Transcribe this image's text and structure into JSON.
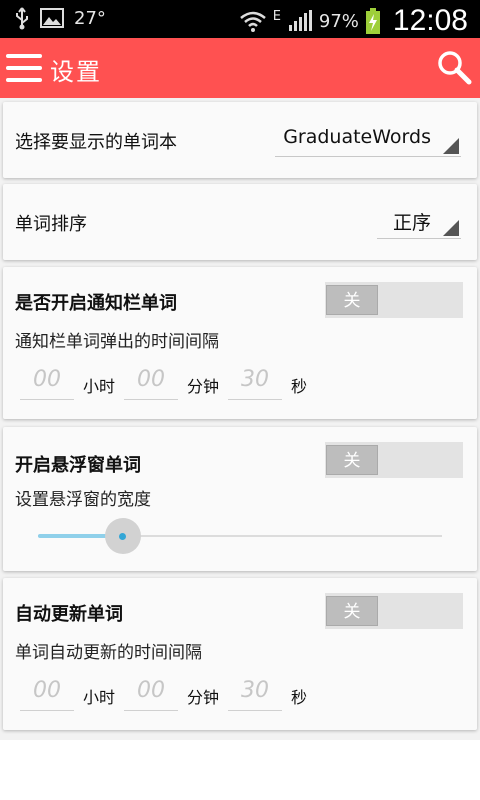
{
  "status_bar": {
    "temperature": "27°",
    "network_type": "E",
    "battery": "97%",
    "time": "12:08",
    "icons": [
      "usb-icon",
      "image-icon",
      "wifi-icon",
      "signal-icon",
      "battery-charging-icon"
    ]
  },
  "app_bar": {
    "title": "设置",
    "menu_icon": "hamburger-menu-icon",
    "search_icon": "search-icon",
    "color": "#ff5151"
  },
  "wordbook": {
    "label": "选择要显示的单词本",
    "selected": "GraduateWords"
  },
  "sort": {
    "label": "单词排序",
    "selected": "正序"
  },
  "notification": {
    "label": "是否开启通知栏单词",
    "toggle_text": "关",
    "interval_label": "通知栏单词弹出的时间间隔",
    "hours_placeholder": "00",
    "hours_unit": "小时",
    "minutes_placeholder": "00",
    "minutes_unit": "分钟",
    "seconds_placeholder": "30",
    "seconds_unit": "秒"
  },
  "floating": {
    "label": "开启悬浮窗单词",
    "toggle_text": "关",
    "width_label": "设置悬浮窗的宽度",
    "slider_value_fraction": 0.21
  },
  "auto_update": {
    "label": "自动更新单词",
    "toggle_text": "关",
    "interval_label": "单词自动更新的时间间隔",
    "hours_placeholder": "00",
    "hours_unit": "小时",
    "minutes_placeholder": "00",
    "minutes_unit": "分钟",
    "seconds_placeholder": "30",
    "seconds_unit": "秒"
  }
}
